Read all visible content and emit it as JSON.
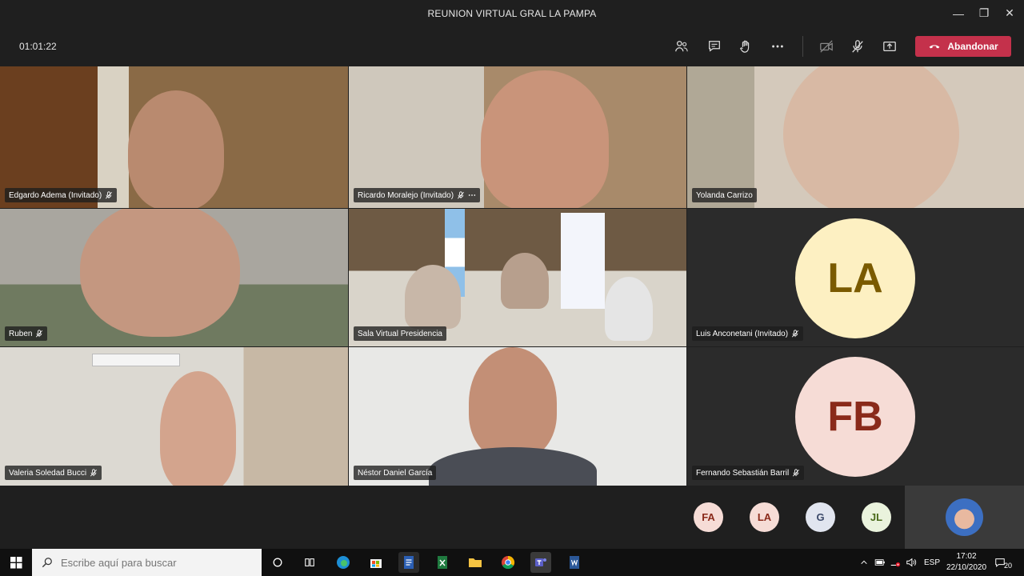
{
  "window": {
    "title": "REUNION VIRTUAL GRAL LA PAMPA",
    "minimize": "—",
    "maximize": "❐",
    "close": "✕"
  },
  "meeting": {
    "elapsed": "01:01:22",
    "leave_label": "Abandonar"
  },
  "participants": [
    {
      "name": "Edgardo Adema (Invitado)"
    },
    {
      "name": "Ricardo Moralejo (Invitado)"
    },
    {
      "name": "Yolanda Carrizo"
    },
    {
      "name": "Ruben"
    },
    {
      "name": "Sala Virtual Presidencia"
    },
    {
      "name": "Luis Anconetani (Invitado)",
      "initials": "LA",
      "color": "#fdf0c2",
      "text_color": "#7a5a00"
    },
    {
      "name": "Valeria Soledad Bucci"
    },
    {
      "name": "Néstor Daniel García"
    },
    {
      "name": "Fernando Sebastián Barril",
      "initials": "FB",
      "color": "#f6dcd6",
      "text_color": "#8a2a1a"
    }
  ],
  "overflow": [
    {
      "initials": "FA",
      "color": "#f6dcd6",
      "text_color": "#8a2a1a"
    },
    {
      "initials": "LA",
      "color": "#f6dcd6",
      "text_color": "#8a2a1a"
    },
    {
      "initials": "G",
      "color": "#e1e5ef",
      "text_color": "#3c4a6a"
    },
    {
      "initials": "JL",
      "color": "#eaf3dd",
      "text_color": "#4a6a1a"
    }
  ],
  "taskbar": {
    "search_placeholder": "Escribe aquí para buscar",
    "language": "ESP",
    "time": "17:02",
    "date": "22/10/2020",
    "notifications": "20"
  }
}
